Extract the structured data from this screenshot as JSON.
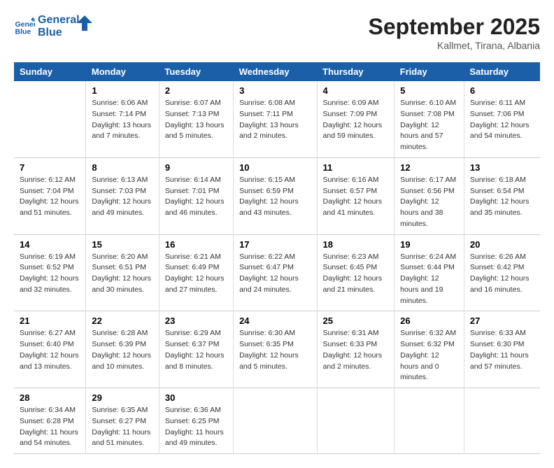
{
  "header": {
    "logo_line1": "General",
    "logo_line2": "Blue",
    "month": "September 2025",
    "location": "Kallmet, Tirana, Albania"
  },
  "days_of_week": [
    "Sunday",
    "Monday",
    "Tuesday",
    "Wednesday",
    "Thursday",
    "Friday",
    "Saturday"
  ],
  "weeks": [
    [
      {
        "day": "",
        "sunrise": "",
        "sunset": "",
        "daylight": ""
      },
      {
        "day": "1",
        "sunrise": "Sunrise: 6:06 AM",
        "sunset": "Sunset: 7:14 PM",
        "daylight": "Daylight: 13 hours and 7 minutes."
      },
      {
        "day": "2",
        "sunrise": "Sunrise: 6:07 AM",
        "sunset": "Sunset: 7:13 PM",
        "daylight": "Daylight: 13 hours and 5 minutes."
      },
      {
        "day": "3",
        "sunrise": "Sunrise: 6:08 AM",
        "sunset": "Sunset: 7:11 PM",
        "daylight": "Daylight: 13 hours and 2 minutes."
      },
      {
        "day": "4",
        "sunrise": "Sunrise: 6:09 AM",
        "sunset": "Sunset: 7:09 PM",
        "daylight": "Daylight: 12 hours and 59 minutes."
      },
      {
        "day": "5",
        "sunrise": "Sunrise: 6:10 AM",
        "sunset": "Sunset: 7:08 PM",
        "daylight": "Daylight: 12 hours and 57 minutes."
      },
      {
        "day": "6",
        "sunrise": "Sunrise: 6:11 AM",
        "sunset": "Sunset: 7:06 PM",
        "daylight": "Daylight: 12 hours and 54 minutes."
      }
    ],
    [
      {
        "day": "7",
        "sunrise": "Sunrise: 6:12 AM",
        "sunset": "Sunset: 7:04 PM",
        "daylight": "Daylight: 12 hours and 51 minutes."
      },
      {
        "day": "8",
        "sunrise": "Sunrise: 6:13 AM",
        "sunset": "Sunset: 7:03 PM",
        "daylight": "Daylight: 12 hours and 49 minutes."
      },
      {
        "day": "9",
        "sunrise": "Sunrise: 6:14 AM",
        "sunset": "Sunset: 7:01 PM",
        "daylight": "Daylight: 12 hours and 46 minutes."
      },
      {
        "day": "10",
        "sunrise": "Sunrise: 6:15 AM",
        "sunset": "Sunset: 6:59 PM",
        "daylight": "Daylight: 12 hours and 43 minutes."
      },
      {
        "day": "11",
        "sunrise": "Sunrise: 6:16 AM",
        "sunset": "Sunset: 6:57 PM",
        "daylight": "Daylight: 12 hours and 41 minutes."
      },
      {
        "day": "12",
        "sunrise": "Sunrise: 6:17 AM",
        "sunset": "Sunset: 6:56 PM",
        "daylight": "Daylight: 12 hours and 38 minutes."
      },
      {
        "day": "13",
        "sunrise": "Sunrise: 6:18 AM",
        "sunset": "Sunset: 6:54 PM",
        "daylight": "Daylight: 12 hours and 35 minutes."
      }
    ],
    [
      {
        "day": "14",
        "sunrise": "Sunrise: 6:19 AM",
        "sunset": "Sunset: 6:52 PM",
        "daylight": "Daylight: 12 hours and 32 minutes."
      },
      {
        "day": "15",
        "sunrise": "Sunrise: 6:20 AM",
        "sunset": "Sunset: 6:51 PM",
        "daylight": "Daylight: 12 hours and 30 minutes."
      },
      {
        "day": "16",
        "sunrise": "Sunrise: 6:21 AM",
        "sunset": "Sunset: 6:49 PM",
        "daylight": "Daylight: 12 hours and 27 minutes."
      },
      {
        "day": "17",
        "sunrise": "Sunrise: 6:22 AM",
        "sunset": "Sunset: 6:47 PM",
        "daylight": "Daylight: 12 hours and 24 minutes."
      },
      {
        "day": "18",
        "sunrise": "Sunrise: 6:23 AM",
        "sunset": "Sunset: 6:45 PM",
        "daylight": "Daylight: 12 hours and 21 minutes."
      },
      {
        "day": "19",
        "sunrise": "Sunrise: 6:24 AM",
        "sunset": "Sunset: 6:44 PM",
        "daylight": "Daylight: 12 hours and 19 minutes."
      },
      {
        "day": "20",
        "sunrise": "Sunrise: 6:26 AM",
        "sunset": "Sunset: 6:42 PM",
        "daylight": "Daylight: 12 hours and 16 minutes."
      }
    ],
    [
      {
        "day": "21",
        "sunrise": "Sunrise: 6:27 AM",
        "sunset": "Sunset: 6:40 PM",
        "daylight": "Daylight: 12 hours and 13 minutes."
      },
      {
        "day": "22",
        "sunrise": "Sunrise: 6:28 AM",
        "sunset": "Sunset: 6:39 PM",
        "daylight": "Daylight: 12 hours and 10 minutes."
      },
      {
        "day": "23",
        "sunrise": "Sunrise: 6:29 AM",
        "sunset": "Sunset: 6:37 PM",
        "daylight": "Daylight: 12 hours and 8 minutes."
      },
      {
        "day": "24",
        "sunrise": "Sunrise: 6:30 AM",
        "sunset": "Sunset: 6:35 PM",
        "daylight": "Daylight: 12 hours and 5 minutes."
      },
      {
        "day": "25",
        "sunrise": "Sunrise: 6:31 AM",
        "sunset": "Sunset: 6:33 PM",
        "daylight": "Daylight: 12 hours and 2 minutes."
      },
      {
        "day": "26",
        "sunrise": "Sunrise: 6:32 AM",
        "sunset": "Sunset: 6:32 PM",
        "daylight": "Daylight: 12 hours and 0 minutes."
      },
      {
        "day": "27",
        "sunrise": "Sunrise: 6:33 AM",
        "sunset": "Sunset: 6:30 PM",
        "daylight": "Daylight: 11 hours and 57 minutes."
      }
    ],
    [
      {
        "day": "28",
        "sunrise": "Sunrise: 6:34 AM",
        "sunset": "Sunset: 6:28 PM",
        "daylight": "Daylight: 11 hours and 54 minutes."
      },
      {
        "day": "29",
        "sunrise": "Sunrise: 6:35 AM",
        "sunset": "Sunset: 6:27 PM",
        "daylight": "Daylight: 11 hours and 51 minutes."
      },
      {
        "day": "30",
        "sunrise": "Sunrise: 6:36 AM",
        "sunset": "Sunset: 6:25 PM",
        "daylight": "Daylight: 11 hours and 49 minutes."
      },
      {
        "day": "",
        "sunrise": "",
        "sunset": "",
        "daylight": ""
      },
      {
        "day": "",
        "sunrise": "",
        "sunset": "",
        "daylight": ""
      },
      {
        "day": "",
        "sunrise": "",
        "sunset": "",
        "daylight": ""
      },
      {
        "day": "",
        "sunrise": "",
        "sunset": "",
        "daylight": ""
      }
    ]
  ]
}
